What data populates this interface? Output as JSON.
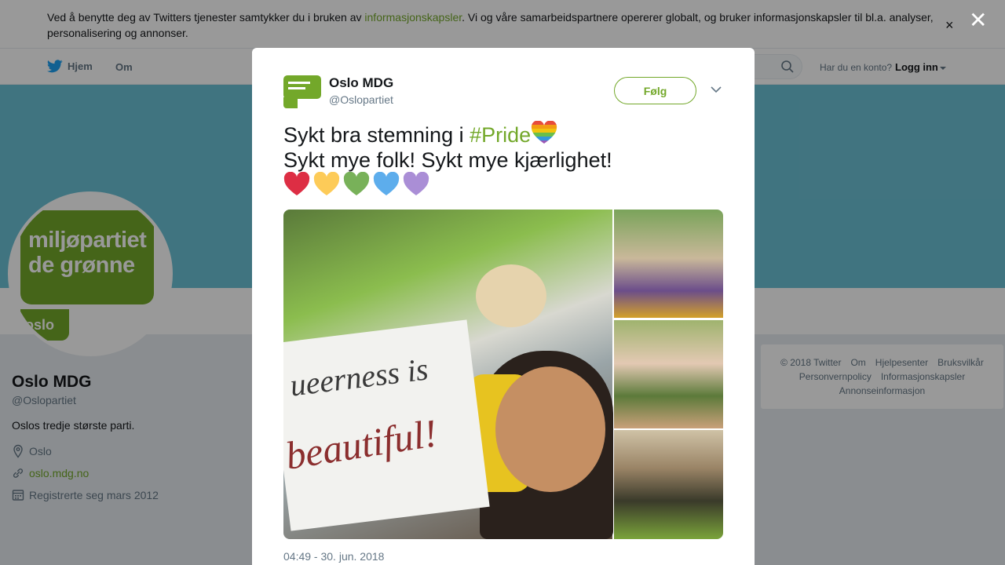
{
  "cookie_banner": {
    "text_before": "Ved å benytte deg av Twitters tjenester samtykker du i bruken av ",
    "link": "informasjonskapsler",
    "text_after": ". Vi og våre samarbeidspartnere opererer globalt, og bruker informasjonskapsler til bl.a. analyser, personalisering og annonser.",
    "close_glyph": "×"
  },
  "nav": {
    "home": "Hjem",
    "about": "Om",
    "account_question": "Har du en konto?",
    "login": "Logg inn"
  },
  "avatar": {
    "line1": "miljøpartiet",
    "line2": "de grønne",
    "city": "oslo"
  },
  "profile": {
    "name": "Oslo MDG",
    "handle": "@Oslopartiet",
    "bio": "Oslos tredje største parti.",
    "location": "Oslo",
    "website": "oslo.mdg.no",
    "joined": "Registrerte seg mars 2012"
  },
  "footer": {
    "row1": [
      "© 2018 Twitter",
      "Om",
      "Hjelpesenter",
      "Bruksvilkår"
    ],
    "row2": [
      "Personvernpolicy",
      "Informasjonskapsler"
    ],
    "row3": [
      "Annonseinformasjon"
    ]
  },
  "modal": {
    "close_glyph": "✕",
    "author_name": "Oslo MDG",
    "author_handle": "@Oslopartiet",
    "follow_label": "Følg",
    "text_line1_before": "Sykt bra stemning i ",
    "hashtag": "#Pride",
    "text_line2": "Sykt mye folk! Sykt mye kjærlighet!",
    "hearts": [
      "#dd2e44",
      "#fdcb58",
      "#78b159",
      "#5dadec",
      "#aa8ed6"
    ],
    "photo_sign_word1": "ueerness  is",
    "photo_sign_word2": "beautiful!",
    "timestamp": "04:49 - 30. jun. 2018"
  },
  "colors": {
    "brand_green": "#73a82a",
    "banner_blue": "#6cc2d6",
    "twitter_blue": "#1da1f2"
  }
}
